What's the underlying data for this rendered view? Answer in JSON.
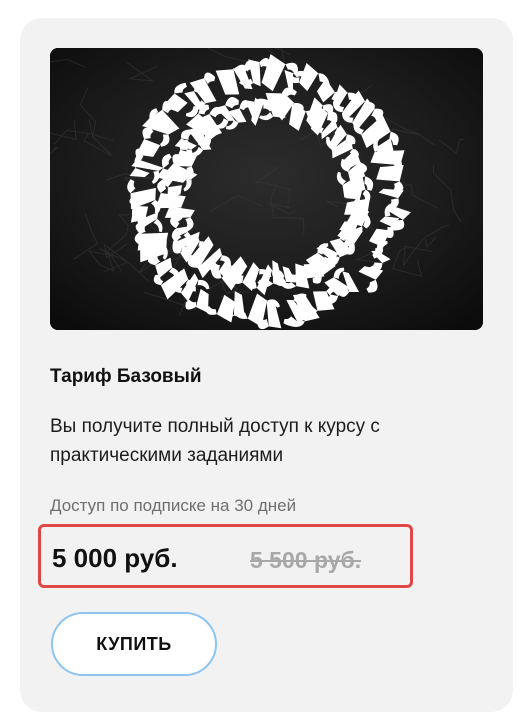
{
  "tariff": {
    "title": "Тариф Базовый",
    "description": "Вы получите полный доступ к курсу с практическими заданиями",
    "access_note": "Доступ по подписке на 30 дней",
    "price_current": "5 000 руб.",
    "price_old": "5 500 руб.",
    "buy_label": "КУПИТЬ",
    "cover_image": "calligraphy-ring-image"
  },
  "colors": {
    "card_bg": "#f2f2f2",
    "highlight_border": "#e04848",
    "button_border": "#8cc4f2",
    "old_price": "#a8a8a8"
  }
}
